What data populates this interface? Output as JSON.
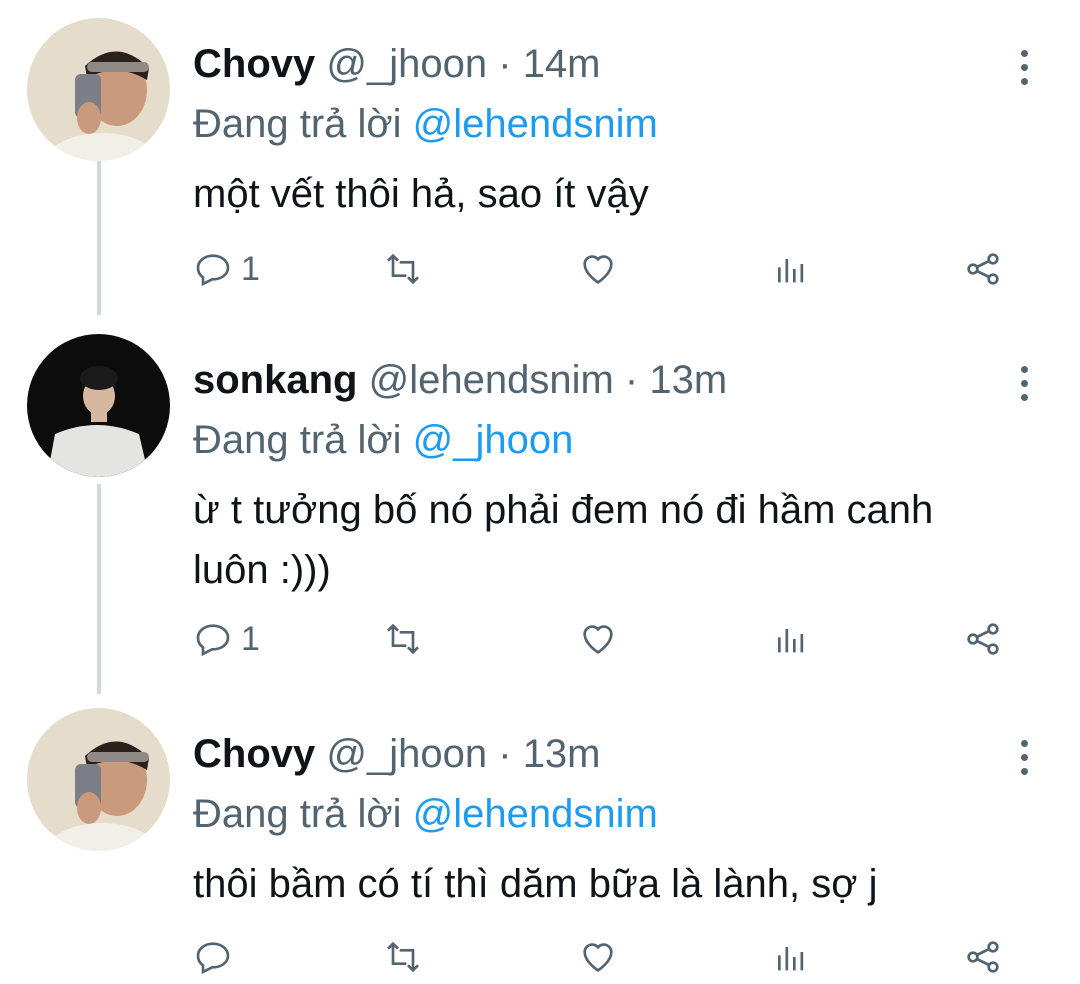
{
  "colors": {
    "accent": "#1d9bf0",
    "muted": "#536471",
    "thread_line": "#cfd9de"
  },
  "tweets": [
    {
      "name": "Chovy",
      "handle": "@_jhoon",
      "sep": "·",
      "time": "14m",
      "replying_prefix": "Đang trả lời",
      "replying_to": "@lehendsnim",
      "text": "một vết thôi hả, sao ít vậy",
      "reply_count": "1",
      "avatar": "avatar-chovy"
    },
    {
      "name": "sonkang",
      "handle": "@lehendsnim",
      "sep": "·",
      "time": "13m",
      "replying_prefix": "Đang trả lời",
      "replying_to": "@_jhoon",
      "text": "ừ t tưởng bố nó phải đem nó đi hầm canh luôn :)))",
      "reply_count": "1",
      "avatar": "avatar-sonkang"
    },
    {
      "name": "Chovy",
      "handle": "@_jhoon",
      "sep": "·",
      "time": "13m",
      "replying_prefix": "Đang trả lời",
      "replying_to": "@lehendsnim",
      "text": "thôi bầm có tí thì dăm bữa là lành, sợ j",
      "reply_count": "",
      "avatar": "avatar-chovy"
    }
  ],
  "icons": {
    "reply": "reply-icon",
    "retweet": "retweet-icon",
    "like": "heart-icon",
    "views": "views-icon",
    "share": "share-icon",
    "more": "more-vertical-icon"
  }
}
